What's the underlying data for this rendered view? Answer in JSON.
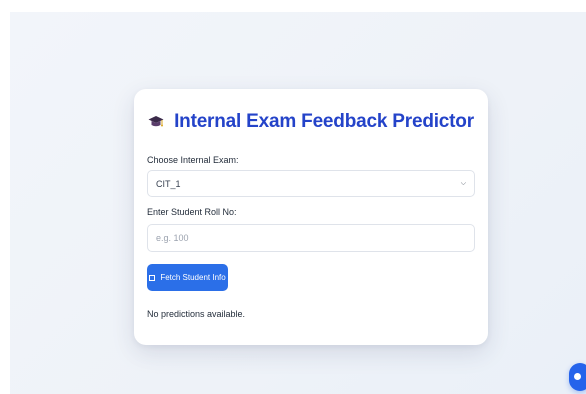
{
  "card": {
    "title": "Internal Exam Feedback Predictor",
    "title_icon": "graduation-cap-icon"
  },
  "exam_select": {
    "label": "Choose Internal Exam:",
    "selected_value": "CIT_1"
  },
  "roll_input": {
    "label": "Enter Student Roll No:",
    "placeholder": "e.g. 100",
    "value": ""
  },
  "fetch_button": {
    "label": "Fetch Student Info",
    "icon": "clipboard-icon"
  },
  "status": {
    "message": "No predictions available."
  },
  "floating_button": {
    "icon": "chat-icon"
  },
  "colors": {
    "accent": "#2443c9",
    "button": "#2b6fe8",
    "background": "#eef2f8"
  }
}
